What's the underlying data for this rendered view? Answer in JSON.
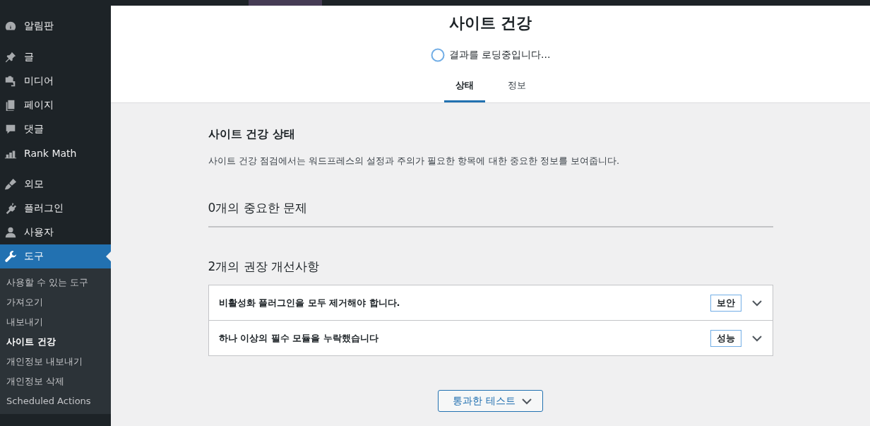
{
  "menu_groups": [
    {
      "items": [
        {
          "label": "알림판",
          "selected": false
        }
      ]
    },
    {
      "items": [
        {
          "label": "글",
          "selected": false
        },
        {
          "label": "미디어",
          "selected": false
        },
        {
          "label": "페이지",
          "selected": false
        },
        {
          "label": "댓글",
          "selected": false
        },
        {
          "label": "Rank Math",
          "selected": false
        }
      ]
    },
    {
      "items": [
        {
          "label": "외모",
          "selected": false
        },
        {
          "label": "플러그인",
          "selected": false
        },
        {
          "label": "사용자",
          "selected": false
        },
        {
          "label": "도구",
          "selected": true
        }
      ]
    }
  ],
  "submenu": [
    {
      "label": "사용할 수 있는 도구",
      "selected": false
    },
    {
      "label": "가져오기",
      "selected": false
    },
    {
      "label": "내보내기",
      "selected": false
    },
    {
      "label": "사이트 건강",
      "selected": true
    },
    {
      "label": "개인정보 내보내기",
      "selected": false
    },
    {
      "label": "개인정보 삭제",
      "selected": false
    },
    {
      "label": "Scheduled Actions",
      "selected": false
    }
  ],
  "header": {
    "title": "사이트 건강",
    "loading": "결과를 로딩중입니다...",
    "tabs": [
      {
        "label": "상태",
        "selected": true
      },
      {
        "label": "정보",
        "selected": false
      }
    ]
  },
  "status": {
    "heading": "사이트 건강 상태",
    "description": "사이트 건강 점검에서는 워드프레스의 설정과 주의가 필요한 항목에 대한 중요한 정보를 보여줍니다.",
    "critical_heading": "0개의 중요한 문제",
    "recommended_heading": "2개의 권장 개선사항",
    "issues": [
      {
        "title": "비활성화 플러그인을 모두 제거해야 합니다.",
        "badge": "보안",
        "expanded": false
      },
      {
        "title": "하나 이상의 필수 모듈을 누락했습니다",
        "badge": "성능",
        "expanded": false
      }
    ],
    "passed_button": {
      "label": "통과한 테스트",
      "expanded": false
    }
  }
}
